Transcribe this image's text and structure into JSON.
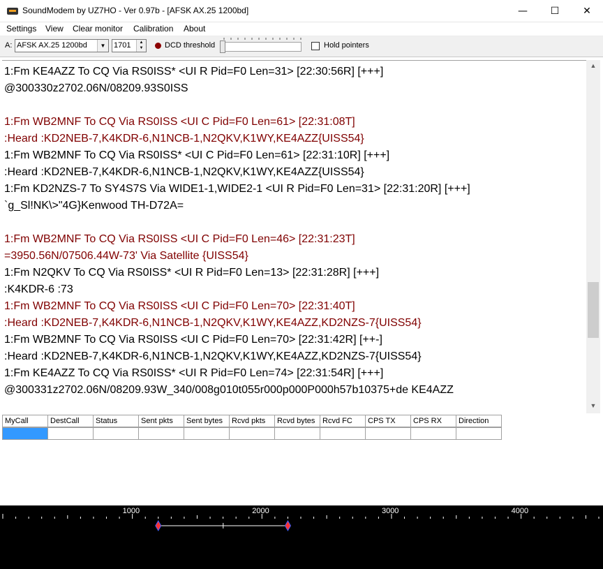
{
  "window": {
    "title": "SoundModem by UZ7HO - Ver 0.97b - [AFSK AX.25 1200bd]",
    "minimize_glyph": "—",
    "maximize_glyph": "☐",
    "close_glyph": "✕"
  },
  "menu": {
    "items": [
      "Settings",
      "View",
      "Clear monitor",
      "Calibration",
      "About"
    ]
  },
  "toolbar": {
    "channel_label": "A:",
    "modem_mode": "AFSK AX.25 1200bd",
    "center_freq": "1701",
    "dcd_label": "DCD threshold",
    "hold_pointers_label": "Hold pointers",
    "hold_pointers_checked": false,
    "dcd_indicator_color": "#8b0000"
  },
  "monitor": {
    "lines": [
      {
        "kind": "rx",
        "text": "1:Fm KE4AZZ To CQ Via RS0ISS* <UI R Pid=F0 Len=31> [22:30:56R] [+++]"
      },
      {
        "kind": "rx",
        "text": "@300330z2702.06N/08209.93S0ISS"
      },
      {
        "kind": "blank",
        "text": ""
      },
      {
        "kind": "tx",
        "text": "1:Fm WB2MNF To CQ Via RS0ISS <UI C Pid=F0 Len=61> [22:31:08T]"
      },
      {
        "kind": "tx",
        "text": ":Heard     :KD2NEB-7,K4KDR-6,N1NCB-1,N2QKV,K1WY,KE4AZZ{UISS54}"
      },
      {
        "kind": "rx",
        "text": "1:Fm WB2MNF To CQ Via RS0ISS* <UI C Pid=F0 Len=61> [22:31:10R] [+++]"
      },
      {
        "kind": "rx",
        "text": ":Heard     :KD2NEB-7,K4KDR-6,N1NCB-1,N2QKV,K1WY,KE4AZZ{UISS54}"
      },
      {
        "kind": "rx",
        "text": "1:Fm KD2NZS-7 To SY4S7S Via WIDE1-1,WIDE2-1 <UI R Pid=F0 Len=31> [22:31:20R] [+++]"
      },
      {
        "kind": "rx",
        "text": "`g_Sl!NK\\>\"4G}Kenwood TH-D72A="
      },
      {
        "kind": "blank",
        "text": ""
      },
      {
        "kind": "tx",
        "text": "1:Fm WB2MNF To CQ Via RS0ISS <UI C Pid=F0 Len=46> [22:31:23T]"
      },
      {
        "kind": "tx",
        "text": "=3950.56N/07506.44W-73' Via Satellite {UISS54}"
      },
      {
        "kind": "rx",
        "text": "1:Fm N2QKV To CQ Via RS0ISS* <UI R Pid=F0 Len=13> [22:31:28R] [+++]"
      },
      {
        "kind": "rx",
        "text": ":K4KDR-6  :73"
      },
      {
        "kind": "tx",
        "text": "1:Fm WB2MNF To CQ Via RS0ISS <UI C Pid=F0 Len=70> [22:31:40T]"
      },
      {
        "kind": "tx",
        "text": ":Heard     :KD2NEB-7,K4KDR-6,N1NCB-1,N2QKV,K1WY,KE4AZZ,KD2NZS-7{UISS54}"
      },
      {
        "kind": "rx",
        "text": "1:Fm WB2MNF To CQ Via RS0ISS <UI C Pid=F0 Len=70> [22:31:42R] [++-]"
      },
      {
        "kind": "rx",
        "text": ":Heard     :KD2NEB-7,K4KDR-6,N1NCB-1,N2QKV,K1WY,KE4AZZ,KD2NZS-7{UISS54}"
      },
      {
        "kind": "rx",
        "text": "1:Fm KE4AZZ To CQ Via RS0ISS* <UI R Pid=F0 Len=74> [22:31:54R] [+++]"
      },
      {
        "kind": "rx",
        "text": "@300331z2702.06N/08209.93W_340/008g010t055r000p000P000h57b10375+de KE4AZZ"
      }
    ],
    "rx_color": "#000000",
    "tx_color": "#800000"
  },
  "connections_table": {
    "columns": [
      "MyCall",
      "DestCall",
      "Status",
      "Sent pkts",
      "Sent bytes",
      "Rcvd pkts",
      "Rcvd bytes",
      "Rcvd FC",
      "CPS TX",
      "CPS RX",
      "Direction"
    ],
    "rows": [
      [
        "",
        "",
        "",
        "",
        "",
        "",
        "",
        "",
        "",
        "",
        ""
      ]
    ],
    "selection_color": "#3399ff"
  },
  "waterfall": {
    "freq_labels": [
      "1000",
      "2000",
      "3000",
      "4000"
    ],
    "min_hz": 0,
    "max_hz": 4600,
    "marker_low_hz": 1200,
    "marker_high_hz": 2200,
    "marker_center_hz": 1701,
    "marker_color": "#ff3030",
    "background": "#000000"
  }
}
